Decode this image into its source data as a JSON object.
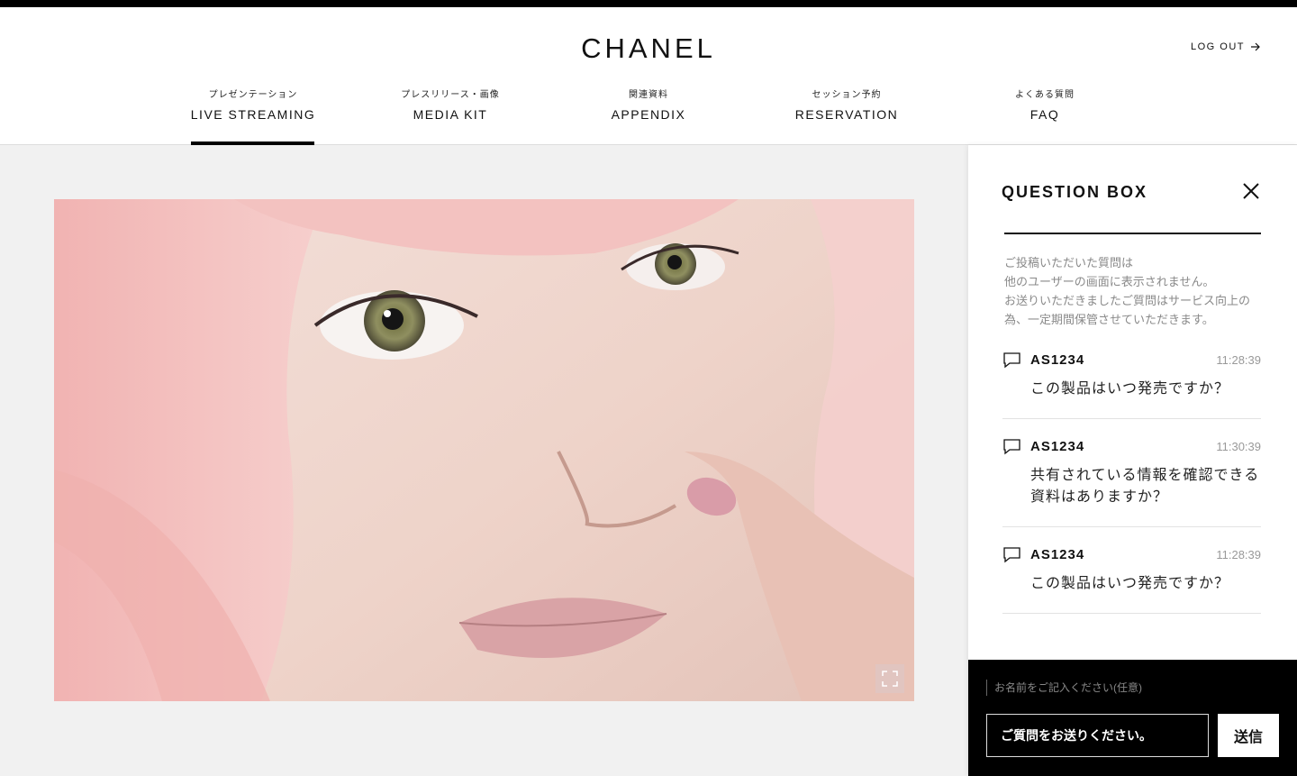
{
  "brand": {
    "logo": "CHANEL"
  },
  "header": {
    "logout_label": "LOG OUT"
  },
  "nav": {
    "items": [
      {
        "sub": "プレゼンテーション",
        "label": "LIVE STREAMING",
        "active": true
      },
      {
        "sub": "プレスリリース・画像",
        "label": "MEDIA KIT",
        "active": false
      },
      {
        "sub": "関連資料",
        "label": "APPENDIX",
        "active": false
      },
      {
        "sub": "セッション予約",
        "label": "RESERVATION",
        "active": false
      },
      {
        "sub": "よくある質問",
        "label": "FAQ",
        "active": false
      }
    ]
  },
  "video": {
    "icon": "fullscreen-icon"
  },
  "panel": {
    "title": "QUESTION BOX",
    "note": "ご投稿いただいた質問は\n他のユーザーの画面に表示されません。\nお送りいただきましたご質問はサービス向上の為、一定期間保管させていただきます。",
    "questions": [
      {
        "user": "AS1234",
        "time": "11:28:39",
        "text": "この製品はいつ発売ですか？"
      },
      {
        "user": "AS1234",
        "time": "11:30:39",
        "text": "共有されている情報を確認できる資料はありますか？"
      },
      {
        "user": "AS1234",
        "time": "11:28:39",
        "text": "この製品はいつ発売ですか？"
      }
    ]
  },
  "compose": {
    "name_placeholder": "お名前をご記入ください(任意)",
    "question_placeholder": "ご質問をお送りください。",
    "send_label": "送信"
  },
  "colors": {
    "accent": "#000000",
    "muted": "#8a8a8a",
    "background": "#f1f1f1"
  }
}
